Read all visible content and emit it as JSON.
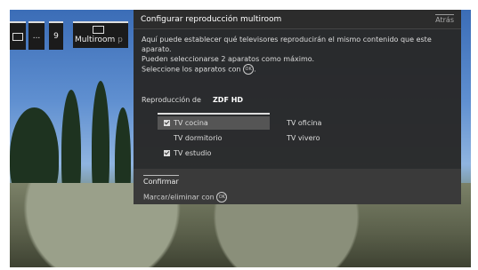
{
  "topbar": {
    "chip2_text": "...",
    "chip3_text": "9",
    "multiroom_label": "Multiroom",
    "multiroom_fade": "p"
  },
  "panel": {
    "title": "Configurar reproducción multiroom",
    "back_label": "Atrás",
    "description_lines": [
      "Aquí puede establecer qué televisores reproducirán el mismo contenido que este",
      "aparato.",
      "Pueden seleccionarse 2 aparatos como máximo.",
      "Seleccione los aparatos con"
    ],
    "ok_icon_text": "OK",
    "playback_label": "Reproducción de",
    "playback_channel": "ZDF HD",
    "tvs": [
      {
        "label": "TV cocina",
        "checked": true,
        "selected": true
      },
      {
        "label": "TV oficina",
        "checked": false,
        "selected": false
      },
      {
        "label": "TV dormitorio",
        "checked": false,
        "selected": false
      },
      {
        "label": "TV vivero",
        "checked": false,
        "selected": false
      },
      {
        "label": "TV estudio",
        "checked": true,
        "selected": false
      }
    ]
  },
  "footer": {
    "confirm_label": "Confirmar",
    "mark_hint": "Marcar/eliminar con",
    "ok_icon_text": "OK"
  }
}
